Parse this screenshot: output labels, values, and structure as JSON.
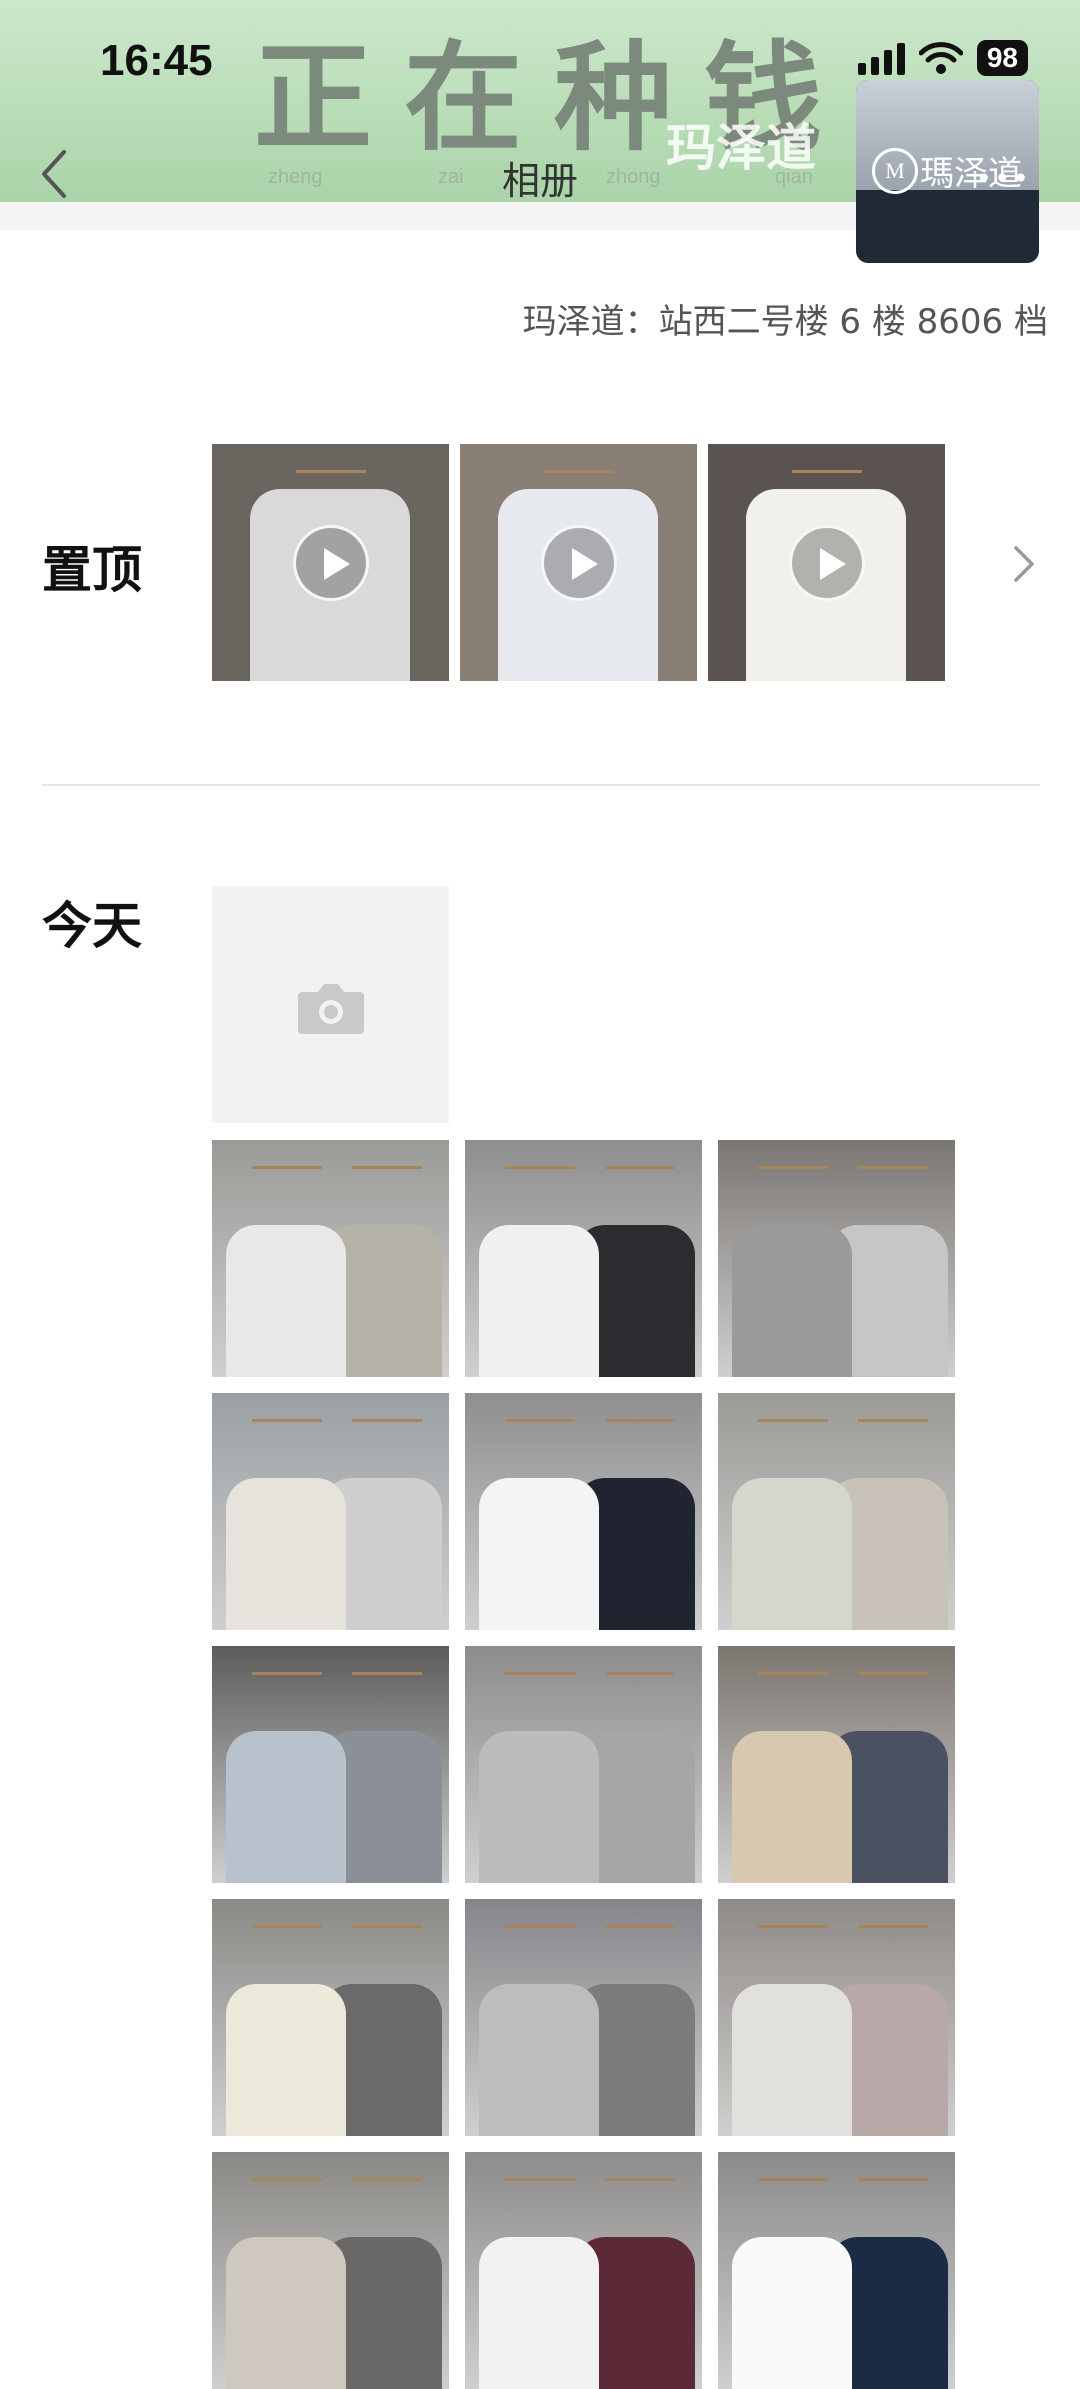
{
  "status_bar": {
    "time": "16:45",
    "battery": "98"
  },
  "banner": {
    "chars": [
      "正",
      "在",
      "种",
      "钱"
    ],
    "pinyin": [
      "zheng",
      "zai",
      "zhong",
      "qian"
    ]
  },
  "nav": {
    "title": "相册",
    "brand_overlay": "玛泽道"
  },
  "logo": {
    "text": "瑪泽道",
    "more": "•••"
  },
  "address": "玛泽道：站西二号楼 6 楼 8606 档",
  "pinned": {
    "label": "置顶",
    "items": [
      {
        "name": "pinned-video-1",
        "bg": "#6b6560",
        "shirt": "#d9d9d9"
      },
      {
        "name": "pinned-video-2",
        "bg": "#8a7f74",
        "shirt": "#e6e9ee"
      },
      {
        "name": "pinned-video-3",
        "bg": "#5a5350",
        "shirt": "#f2f0ea"
      }
    ]
  },
  "today": {
    "label": "今天",
    "photos": [
      {
        "bg": "#9a9a96",
        "shirt": "#e8e8e6",
        "shirt2": "#b5b2a8"
      },
      {
        "bg": "#8e8e8e",
        "shirt": "#f0f0f0",
        "shirt2": "#2c2c30"
      },
      {
        "bg": "#7a7672",
        "shirt": "#9a9a9a",
        "shirt2": "#c6c6c6"
      },
      {
        "bg": "#9aa0a2",
        "shirt": "#e6e2dc",
        "shirt2": "#cfcfcf"
      },
      {
        "bg": "#8f8f8f",
        "shirt": "#f4f4f4",
        "shirt2": "#1f2430"
      },
      {
        "bg": "#9c9a96",
        "shirt": "#d4d8cc",
        "shirt2": "#c8c2b8"
      },
      {
        "bg": "#5c5c5c",
        "shirt": "#b8c2cc",
        "shirt2": "#8a8f98"
      },
      {
        "bg": "#8c8c8c",
        "shirt": "#bcbcbc",
        "shirt2": "#a6a6a6"
      },
      {
        "bg": "#7c7670",
        "shirt": "#d8c8b0",
        "shirt2": "#4a5262"
      },
      {
        "bg": "#8a8a86",
        "shirt": "#ece8da",
        "shirt2": "#6a6a6a"
      },
      {
        "bg": "#86868a",
        "shirt": "#bdbdbd",
        "shirt2": "#7c7c7c"
      },
      {
        "bg": "#8e8a86",
        "shirt": "#e2e0dc",
        "shirt2": "#b8a8a8"
      },
      {
        "bg": "#8a8884",
        "shirt": "#cfc8be",
        "shirt2": "#6a6866"
      },
      {
        "bg": "#8e8c8a",
        "shirt": "#f2f2f2",
        "shirt2": "#5c2a36"
      },
      {
        "bg": "#8a8a8a",
        "shirt": "#fafafa",
        "shirt2": "#1c2a44"
      }
    ]
  }
}
